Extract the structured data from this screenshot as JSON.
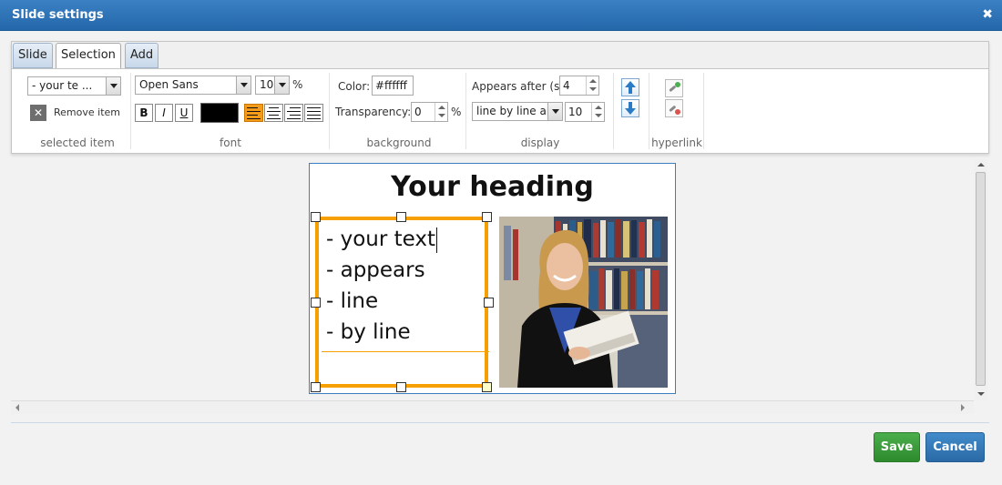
{
  "window": {
    "title": "Slide settings"
  },
  "tabs": [
    {
      "label": "Slide"
    },
    {
      "label": "Selection"
    },
    {
      "label": "Add"
    }
  ],
  "ribbon": {
    "selected_item": {
      "item_select_value": "- your te ...",
      "remove_label": "Remove item",
      "group_label": "selected item"
    },
    "font": {
      "family_value": "Open Sans",
      "size_value": "10",
      "size_unit": "%",
      "bold_label": "B",
      "italic_label": "I",
      "underline_label": "U",
      "text_color": "#000000",
      "group_label": "font"
    },
    "background": {
      "color_label": "Color:",
      "color_value": "#ffffff",
      "transparency_label": "Transparency:",
      "transparency_value": "0",
      "transparency_unit": "%",
      "group_label": "background"
    },
    "display": {
      "appears_label": "Appears after (s):",
      "appears_value": "4",
      "mode_value": "line by line ap",
      "mode_number": "10",
      "group_label": "display"
    },
    "hyperlink": {
      "group_label": "hyperlink"
    }
  },
  "slide": {
    "heading": "Your heading",
    "lines": [
      "- your text",
      "- appears",
      "- line",
      "- by line"
    ]
  },
  "footer": {
    "save_label": "Save",
    "cancel_label": "Cancel"
  },
  "colors": {
    "titlebar": "#2d72b5",
    "selection": "#f5a000",
    "save": "#3d9c3d",
    "cancel": "#357ebd"
  }
}
